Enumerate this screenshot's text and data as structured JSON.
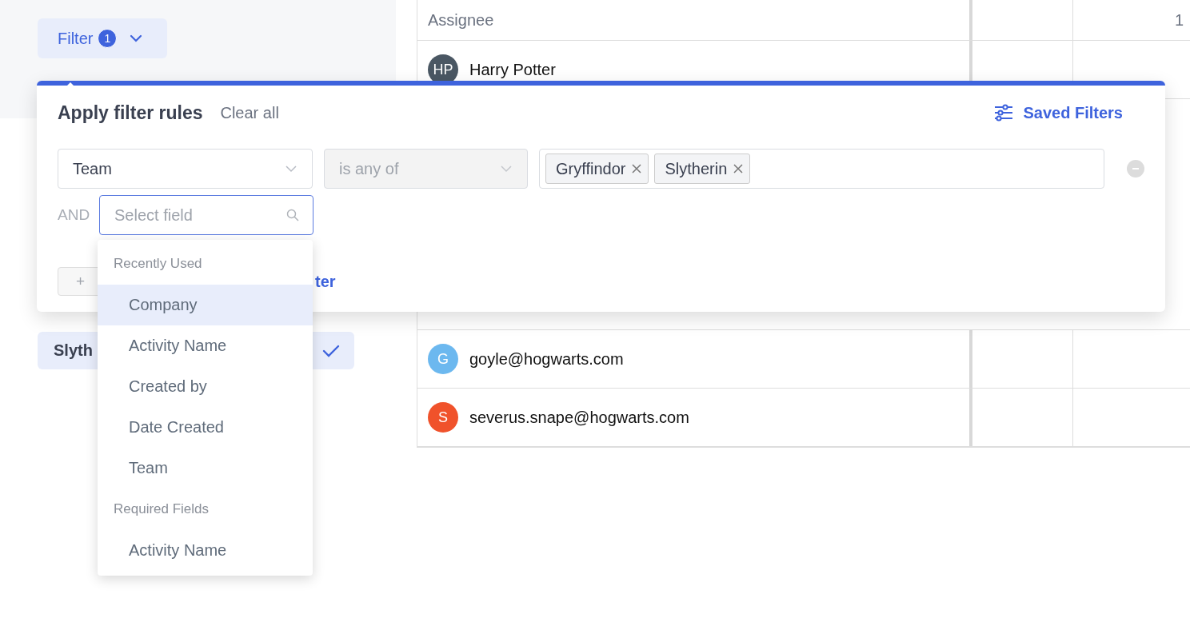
{
  "filter_button": {
    "label": "Filter",
    "count": "1"
  },
  "sidebar": {
    "items": [
      {
        "label": "Slyth",
        "selected": true
      }
    ]
  },
  "table": {
    "header": {
      "assignee": "Assignee",
      "column_3": "1"
    },
    "rows": [
      {
        "initials": "HP",
        "name": "Harry Potter",
        "color": "#4a5763"
      },
      {
        "initials": "G",
        "name": "goyle@hogwarts.com",
        "color": "#6cb8ef"
      },
      {
        "initials": "S",
        "name": "severus.snape@hogwarts.com",
        "color": "#f0522b"
      }
    ]
  },
  "filter_popover": {
    "title": "Apply filter rules",
    "clear_label": "Clear all",
    "saved_filters_label": "Saved Filters",
    "rules": [
      {
        "field": "Team",
        "operator": "is any of",
        "operator_disabled": true,
        "values": [
          "Gryffindor",
          "Slytherin"
        ]
      }
    ],
    "conjunction": "AND",
    "field_search": {
      "placeholder": "Select field"
    },
    "add_button": "+",
    "link": "ter"
  },
  "field_dropdown": {
    "groups": [
      {
        "title": "Recently Used",
        "items": [
          {
            "label": "Company",
            "selected": true
          },
          {
            "label": "Activity Name",
            "selected": false
          },
          {
            "label": "Created by",
            "selected": false
          },
          {
            "label": "Date Created",
            "selected": false
          },
          {
            "label": "Team",
            "selected": false
          }
        ]
      },
      {
        "title": "Required Fields",
        "items": [
          {
            "label": "Activity Name",
            "selected": false
          }
        ]
      }
    ]
  }
}
